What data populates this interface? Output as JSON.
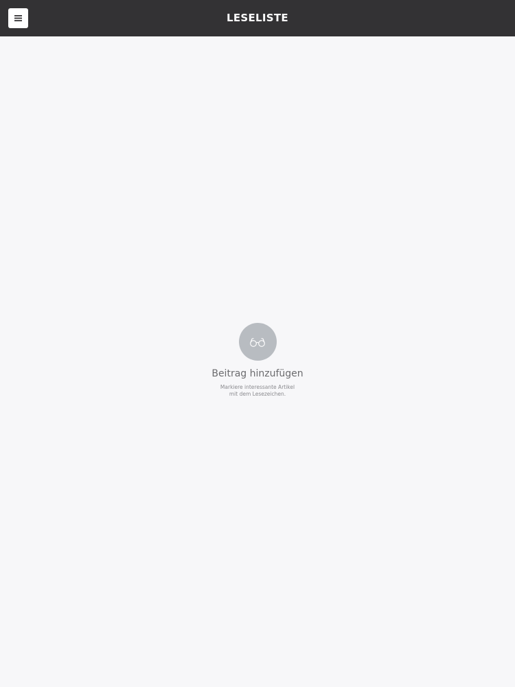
{
  "header": {
    "title": "LESELISTE",
    "menu_icon": "hamburger-menu-icon"
  },
  "empty_state": {
    "icon": "glasses-icon",
    "title": "Beitrag hinzufügen",
    "description_line1": "Markiere interessante Artikel",
    "description_line2": "mit dem Lesezeichen."
  },
  "colors": {
    "header_bg": "#333234",
    "page_bg": "#f7f7f9",
    "icon_circle": "#b8bcc1"
  }
}
